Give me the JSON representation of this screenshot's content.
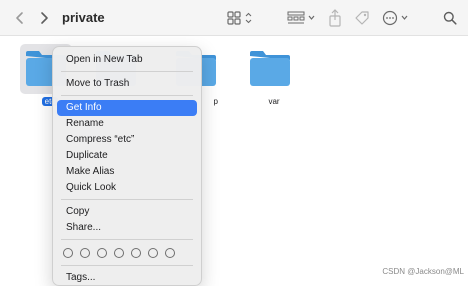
{
  "window": {
    "title": "private"
  },
  "toolbar": {
    "back_icon": "chevron-left-icon",
    "forward_icon": "chevron-right-icon",
    "view_icon": "grid-view-icon",
    "group_icon": "group-by-icon",
    "share_icon": "share-icon",
    "tag_icon": "tag-icon",
    "more_icon": "ellipsis-circle-icon",
    "search_icon": "search-icon"
  },
  "folders": [
    {
      "name": "etc",
      "selected": true
    },
    {
      "name": "",
      "selected": false
    },
    {
      "name": "p",
      "selected": false
    },
    {
      "name": "var",
      "selected": false
    }
  ],
  "context_menu": {
    "open_new_tab": "Open in New Tab",
    "move_to_trash": "Move to Trash",
    "get_info": "Get Info",
    "rename": "Rename",
    "compress": "Compress “etc”",
    "duplicate": "Duplicate",
    "make_alias": "Make Alias",
    "quick_look": "Quick Look",
    "copy": "Copy",
    "share": "Share...",
    "tags": "Tags..."
  },
  "colors": {
    "folder_blue": "#5aa9e6",
    "folder_tab": "#3f93d8",
    "highlight": "#3b7df5"
  },
  "watermark": "CSDN @Jackson@ML"
}
